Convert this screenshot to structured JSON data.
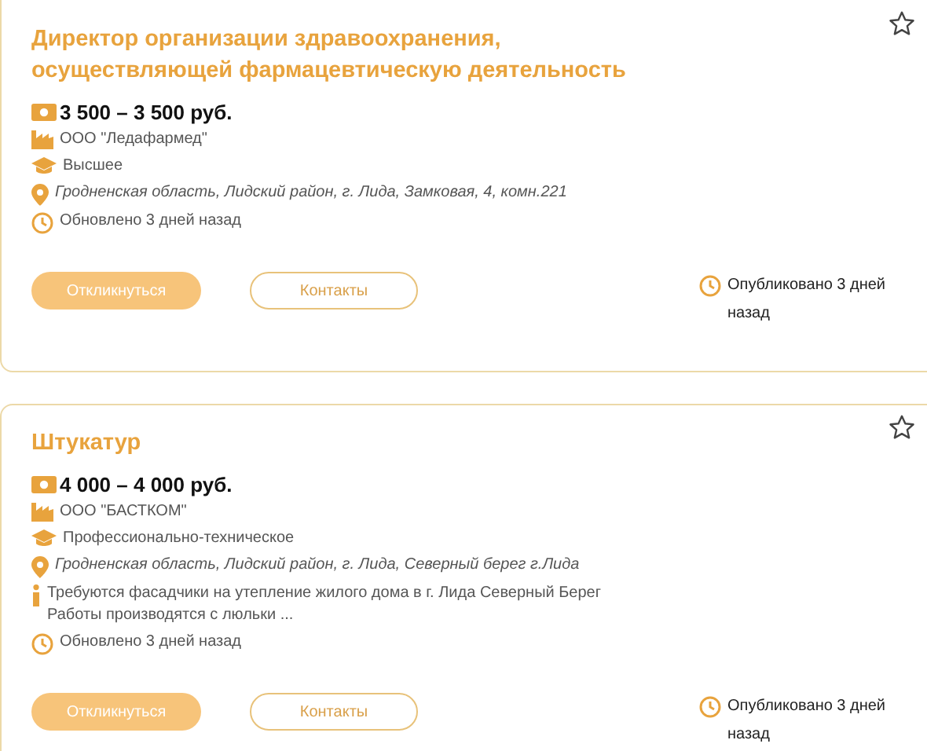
{
  "vacancies": [
    {
      "title": "Директор организации здравоохранения, осуществляющей фармацевтическую деятельность",
      "favorite": false,
      "salary": "3 500 – 3 500 руб.",
      "details": [
        {
          "kind": "company",
          "text": "ООО \"Ледафармед\""
        },
        {
          "kind": "education",
          "text": "Высшее"
        },
        {
          "kind": "address",
          "text": "Гродненская область, Лидский район, г. Лида, Замковая, 4, комн.221"
        },
        {
          "kind": "updated",
          "text": "Обновлено 3 дней назад"
        }
      ],
      "apply_button": "Откликнуться",
      "contacts_button": "Контакты",
      "published": "Опубликовано 3 дней назад"
    },
    {
      "title": "Штукатур",
      "favorite": false,
      "salary": "4 000 – 4 000 руб.",
      "details": [
        {
          "kind": "company",
          "text": "ООО \"БАСТКОМ\""
        },
        {
          "kind": "education",
          "text": "Профессионально-техническое"
        },
        {
          "kind": "address",
          "text": "Гродненская область, Лидский район, г. Лида, Северный берег г.Лида"
        },
        {
          "kind": "description",
          "text": "Требуются фасадчики на утепление жилого дома в г. Лида Северный Берег Работы производятся с люльки ..."
        },
        {
          "kind": "updated",
          "text": "Обновлено 3 дней назад"
        }
      ],
      "apply_button": "Откликнуться",
      "contacts_button": "Контакты",
      "published": "Опубликовано 3 дней назад"
    }
  ]
}
